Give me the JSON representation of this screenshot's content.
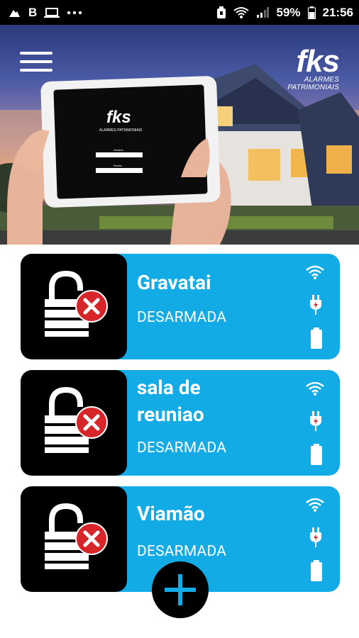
{
  "status_bar": {
    "left_label": "B",
    "battery_percent": "59%",
    "time": "21:56",
    "icons": [
      "cloud-icon",
      "b-icon",
      "laptop-icon",
      "more-dots-icon",
      "alarm-icon",
      "wifi-icon",
      "signal-icon",
      "battery-icon"
    ]
  },
  "header": {
    "brand": "fks",
    "brand_sub": "ALARMES PATRIMONIAIS",
    "tablet_brand": "fks",
    "tablet_sub": "ALARMES PATRIMONIAIS",
    "tablet_field1": "Usuário",
    "tablet_field2": "Senha"
  },
  "cards": [
    {
      "name": "Gravatai",
      "status": "DESARMADA"
    },
    {
      "name": "sala de reuniao",
      "status": "DESARMADA"
    },
    {
      "name": "Viamão",
      "status": "DESARMADA"
    }
  ],
  "colors": {
    "card": "#12abe6",
    "lockbox": "#000000",
    "alert": "#d7262a",
    "fab_plus": "#12abe6"
  },
  "fab": {
    "icon": "plus-icon"
  }
}
